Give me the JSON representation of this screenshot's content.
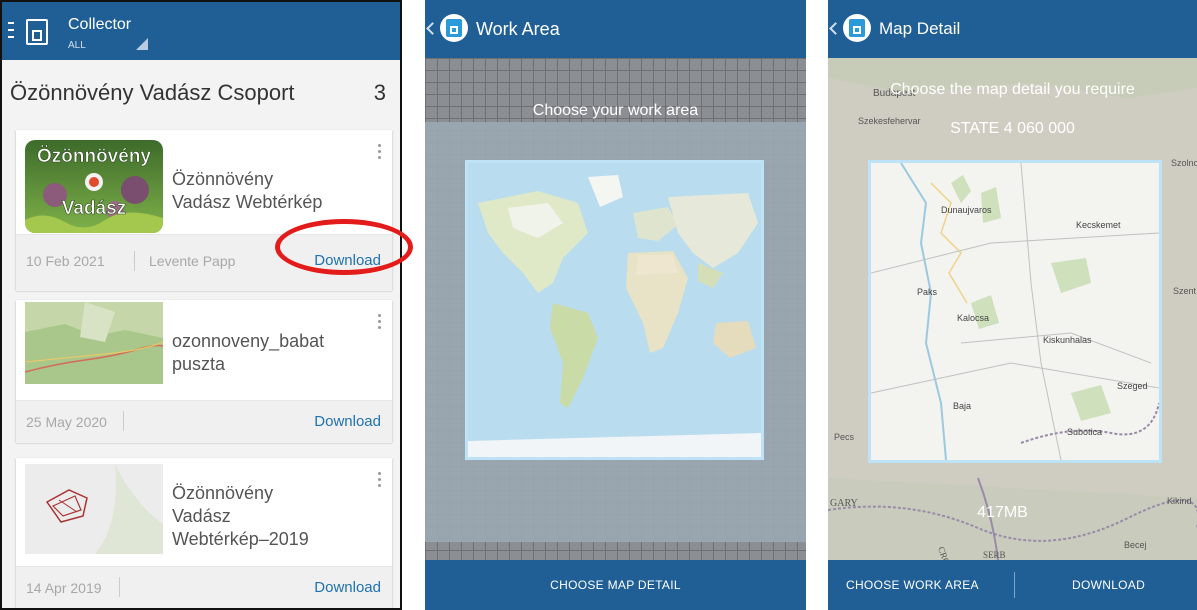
{
  "left_screen": {
    "app_title": "Collector",
    "filter_label": "ALL",
    "group_title": "Özönnövény Vadász Csoport",
    "group_count": "3",
    "cards": [
      {
        "thumb_text_top": "Özönnövény",
        "thumb_text_bottom": "Vadász",
        "name_line1": "Özönnövény",
        "name_line2": "Vadász Webtérkép",
        "date": "10 Feb 2021",
        "author": "Levente Papp",
        "download_label": "Download"
      },
      {
        "name_line1": "ozonnoveny_babat",
        "name_line2": "puszta",
        "date": "25 May 2020",
        "author": "",
        "download_label": "Download"
      },
      {
        "name_line1": "Özönnövény",
        "name_line2": "Vadász",
        "name_line3": "Webtérkép–2019",
        "date": "14 Apr 2019",
        "author": "",
        "download_label": "Download"
      }
    ]
  },
  "middle_screen": {
    "title": "Work Area",
    "instruction": "Choose your work area",
    "bottom_button": "CHOOSE MAP DETAIL"
  },
  "right_screen": {
    "title": "Map Detail",
    "instruction": "Choose the map detail you require",
    "scale": "STATE 4 060 000",
    "size": "417MB",
    "buttons": [
      "CHOOSE WORK AREA",
      "DOWNLOAD"
    ],
    "map_labels_outside": [
      "Budapest",
      "Szekesfehervar",
      "Szolno",
      "Pecs",
      "GARY",
      "CROATIA",
      "SERB",
      "Becej",
      "Kikind",
      "Szent"
    ],
    "map_labels_inside": [
      "Dunaujvaros",
      "Kecskemet",
      "Paks",
      "Kalocsa",
      "Kiskunhalas",
      "Szeged",
      "Baja",
      "Subotica"
    ]
  },
  "colors": {
    "bar_blue": "#1f5f95",
    "link_blue": "#1f72ad",
    "highlight_red": "#e31b1b"
  }
}
